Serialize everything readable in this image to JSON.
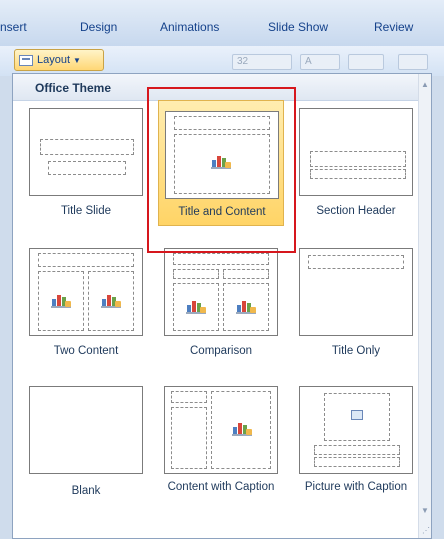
{
  "ribbon": {
    "tabs": [
      "nsert",
      "Design",
      "Animations",
      "Slide Show",
      "Review"
    ]
  },
  "toolbar": {
    "layout_label": "Layout",
    "font_size_value": "32",
    "font_grow_label": "A",
    "font_shrink_label": "A"
  },
  "gallery": {
    "section_title": "Office Theme",
    "selected": "Title and Content",
    "layouts": [
      {
        "name": "Title Slide"
      },
      {
        "name": "Title and Content"
      },
      {
        "name": "Section Header"
      },
      {
        "name": "Two Content"
      },
      {
        "name": "Comparison"
      },
      {
        "name": "Title Only"
      },
      {
        "name": "Blank"
      },
      {
        "name": "Content with Caption"
      },
      {
        "name": "Picture with Caption"
      }
    ]
  },
  "colors": {
    "selection_fill": "#ffd466",
    "selection_border": "#e0b34e",
    "annotation_red": "#d6171d",
    "ribbon_text": "#15428b"
  },
  "icons": [
    "layout-icon",
    "chevron-down-icon",
    "content-placeholder-icon",
    "picture-placeholder-icon",
    "scroll-up-icon",
    "scroll-down-icon",
    "resize-grip-icon"
  ]
}
